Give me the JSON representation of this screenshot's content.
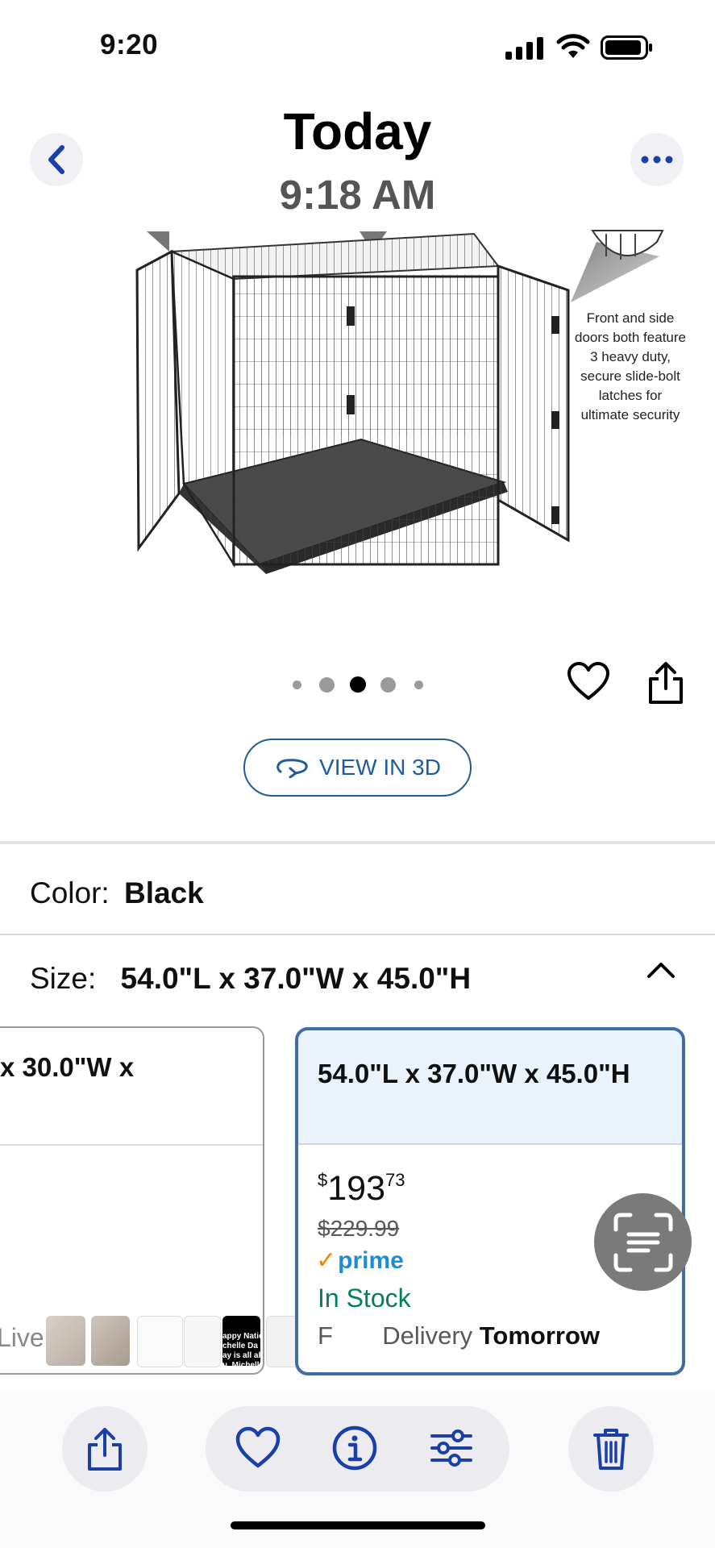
{
  "status_bar": {
    "time": "9:20"
  },
  "header": {
    "title": "Today",
    "subtitle": "9:18 AM"
  },
  "product_image": {
    "callout": "Front and side doors both feature 3 heavy duty, secure slide-bolt latches for ultimate security"
  },
  "carousel": {
    "count": 5,
    "active_index": 2
  },
  "view3d": {
    "label": "VIEW IN 3D"
  },
  "color": {
    "label": "Color:",
    "value": "Black"
  },
  "size": {
    "label": "Size:",
    "value": "54.0\"L x 37.0\"W x 45.0\"H"
  },
  "size_cards": {
    "left": {
      "title": "x 30.0\"W x",
      "delivery": "Livery"
    },
    "right": {
      "title": "54.0\"L x 37.0\"W x 45.0\"H",
      "price_currency": "$",
      "price_whole": "193",
      "price_fraction": "73",
      "list_price": "$229.99",
      "prime": "prime",
      "stock": "In Stock",
      "delivery_prefix": "F",
      "delivery_middle": "Delivery",
      "delivery_when": "Tomorrow"
    }
  },
  "thumbnails": {
    "thumb5_text": "appy Nation\nchelle Da\nay is all ab\nu, Michell"
  },
  "colors": {
    "accent": "#1f5c99",
    "prime_blue": "#1f8bd3",
    "stock_green": "#067d62",
    "toolbar_blue": "#1a3fa6"
  },
  "icons": [
    "back-icon",
    "more-icon",
    "heart-icon",
    "share-icon",
    "rotate-3d-icon",
    "chevron-up-icon",
    "live-text-icon",
    "info-icon",
    "adjust-icon",
    "trash-icon"
  ]
}
